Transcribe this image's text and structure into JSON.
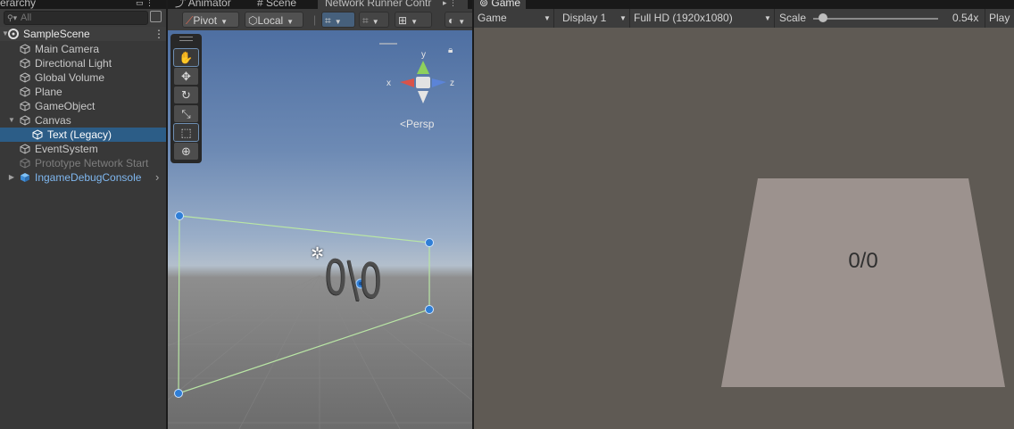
{
  "tabs": {
    "hierarchy": "erarchy",
    "animator": "Animator",
    "scene": "Scene",
    "network": "Network Runner Contr",
    "game": "Game"
  },
  "hierarchy": {
    "search_placeholder": "All",
    "scene_name": "SampleScene",
    "items": [
      {
        "label": "Main Camera"
      },
      {
        "label": "Directional Light"
      },
      {
        "label": "Global Volume"
      },
      {
        "label": "Plane"
      },
      {
        "label": "GameObject"
      },
      {
        "label": "Canvas"
      },
      {
        "label": "Text (Legacy)"
      },
      {
        "label": "EventSystem"
      },
      {
        "label": "Prototype Network Start"
      },
      {
        "label": "IngameDebugConsole"
      }
    ]
  },
  "scene": {
    "pivot_label": "Pivot",
    "local_label": "Local",
    "gizmo": {
      "x": "x",
      "y": "y",
      "z": "z",
      "persp": "Persp"
    },
    "world_text": "0/0"
  },
  "game": {
    "mode_label": "Game",
    "display_label": "Display 1",
    "resolution_label": "Full HD (1920x1080)",
    "scale_label": "Scale",
    "scale_value": "0.54x",
    "play_label": "Play",
    "scale_fraction": 0.08,
    "panel_text": "0/0"
  },
  "colors": {
    "selection": "#2c5d87",
    "prefab_text": "#7fb7ef",
    "gizmo_x": "#d9534a",
    "gizmo_y": "#8ed05c",
    "gizmo_z": "#5b84d8",
    "rect_handle": "#2f7ed6",
    "game_background": "#5f5a54",
    "panel_color": "#9c928e"
  }
}
